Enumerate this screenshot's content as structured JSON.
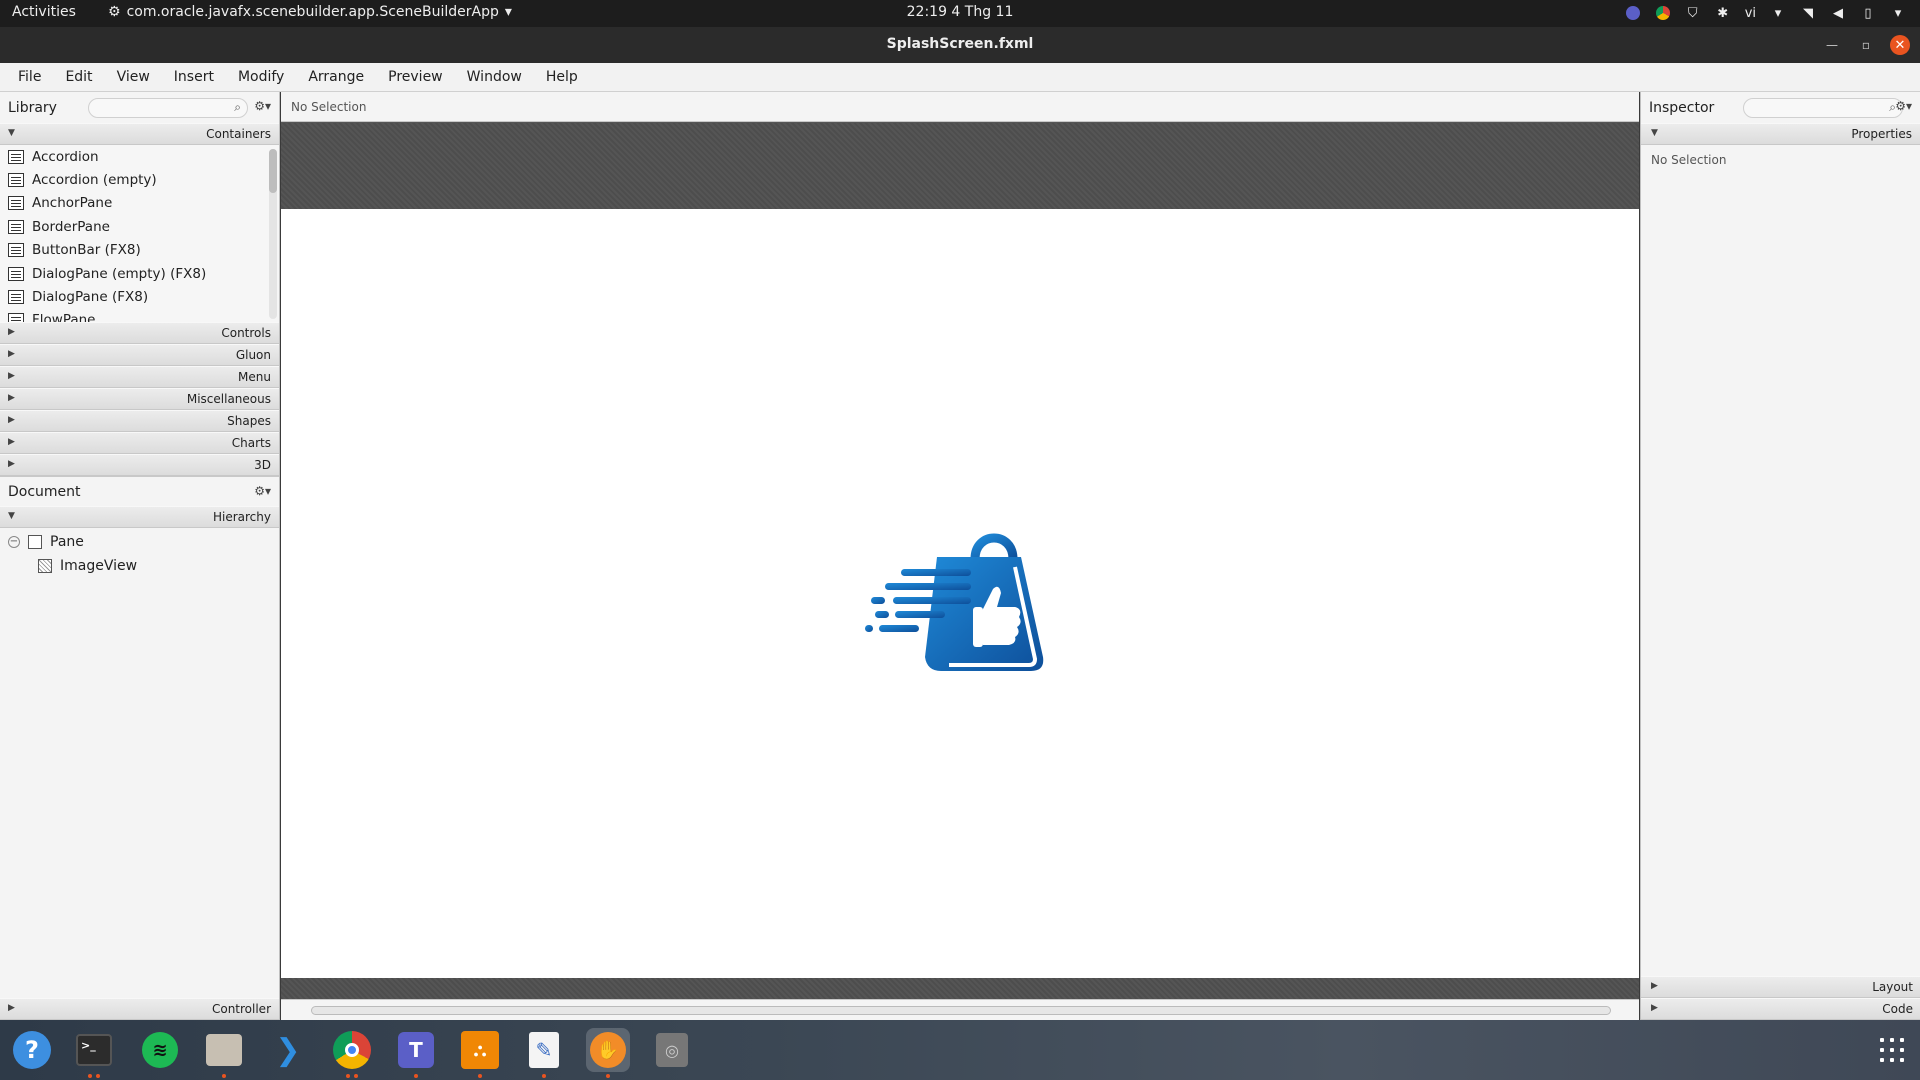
{
  "topbar": {
    "activities": "Activities",
    "app_name": "com.oracle.javafx.scenebuilder.app.SceneBuilderApp",
    "clock": "22:19  4 Thg 11",
    "lang": "vi"
  },
  "window": {
    "title": "SplashScreen.fxml"
  },
  "menu": [
    "File",
    "Edit",
    "View",
    "Insert",
    "Modify",
    "Arrange",
    "Preview",
    "Window",
    "Help"
  ],
  "library": {
    "title": "Library",
    "containers_label": "Containers",
    "items": [
      "Accordion",
      "Accordion  (empty)",
      "AnchorPane",
      "BorderPane",
      "ButtonBar  (FX8)",
      "DialogPane (empty)  (FX8)",
      "DialogPane  (FX8)",
      "FlowPane"
    ],
    "sections": [
      "Controls",
      "Gluon",
      "Menu",
      "Miscellaneous",
      "Shapes",
      "Charts",
      "3D"
    ]
  },
  "document": {
    "title": "Document",
    "hierarchy_label": "Hierarchy",
    "tree": {
      "root": "Pane",
      "child": "ImageView"
    },
    "controller_label": "Controller"
  },
  "center": {
    "selection": "No Selection"
  },
  "inspector": {
    "title": "Inspector",
    "properties_label": "Properties",
    "no_selection": "No Selection",
    "layout_label": "Layout",
    "code_label": "Code"
  },
  "colors": {
    "accent": "#e95420",
    "logo_blue": "#1a6fc0"
  }
}
